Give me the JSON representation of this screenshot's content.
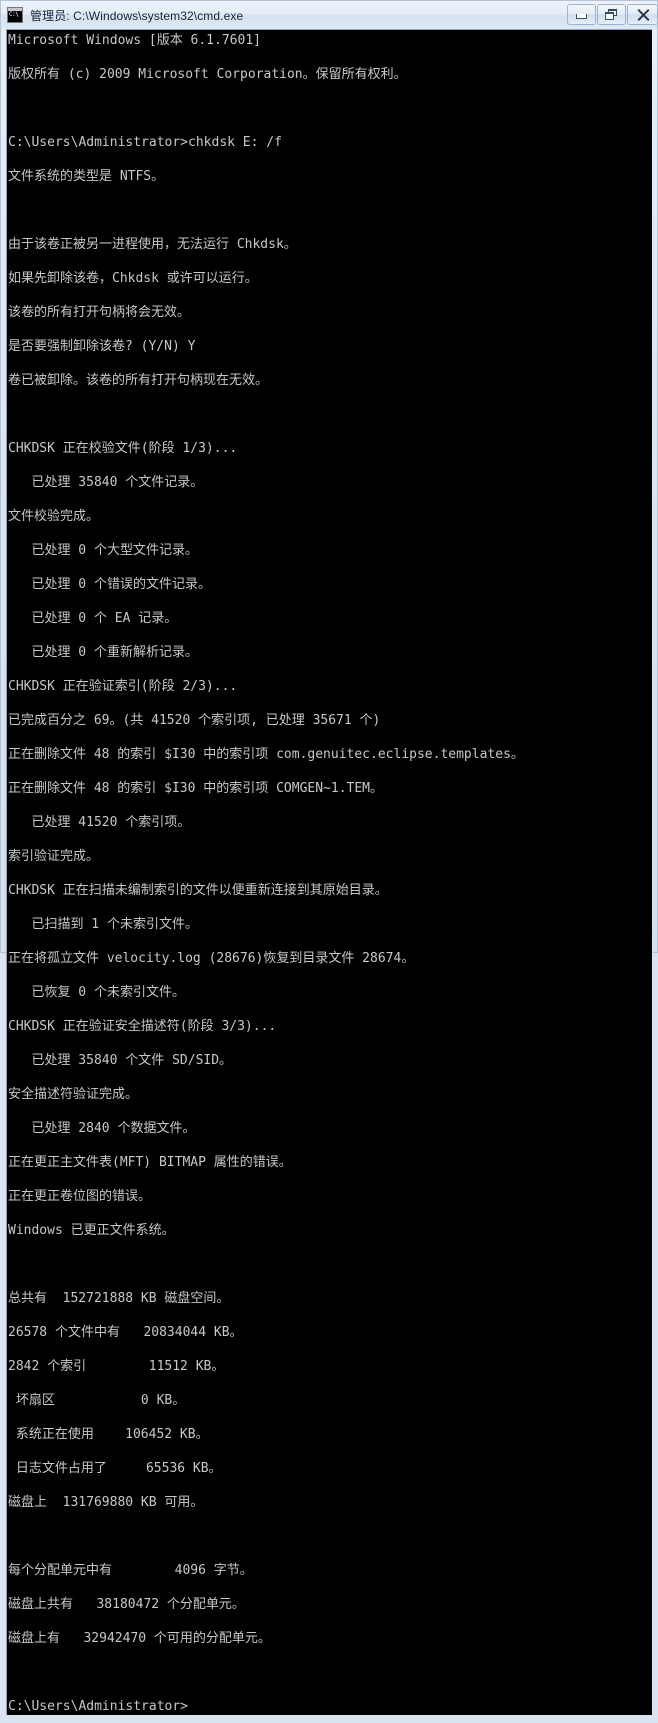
{
  "window": {
    "title": "管理员: C:\\Windows\\system32\\cmd.exe",
    "icon": "cmd-console-icon",
    "icon_glyph": "C:\\",
    "frame_color": "#d9e4f0",
    "titlebar_text_color": "#16243b",
    "controls": {
      "minimize": "最小化",
      "restore": "还原",
      "close": "关闭"
    }
  },
  "console": {
    "background": "#000000",
    "foreground": "#c8c8c8",
    "font_size_px": 13,
    "line_height_px": 17,
    "lines": [
      "Microsoft Windows [版本 6.1.7601]",
      "版权所有 (c) 2009 Microsoft Corporation。保留所有权利。",
      "",
      "C:\\Users\\Administrator>chkdsk E: /f",
      "文件系统的类型是 NTFS。",
      "",
      "由于该卷正被另一进程使用，无法运行 Chkdsk。",
      "如果先卸除该卷，Chkdsk 或许可以运行。",
      "该卷的所有打开句柄将会无效。",
      "是否要强制卸除该卷? (Y/N) Y",
      "卷已被卸除。该卷的所有打开句柄现在无效。",
      "",
      "CHKDSK 正在校验文件(阶段 1/3)...",
      "   已处理 35840 个文件记录。",
      "文件校验完成。",
      "   已处理 0 个大型文件记录。",
      "   已处理 0 个错误的文件记录。",
      "   已处理 0 个 EA 记录。",
      "   已处理 0 个重新解析记录。",
      "CHKDSK 正在验证索引(阶段 2/3)...",
      "已完成百分之 69。(共 41520 个索引项, 已处理 35671 个)",
      "正在删除文件 48 的索引 $I30 中的索引项 com.genuitec.eclipse.templates。",
      "正在删除文件 48 的索引 $I30 中的索引项 COMGEN~1.TEM。",
      "   已处理 41520 个索引项。",
      "索引验证完成。",
      "CHKDSK 正在扫描未编制索引的文件以便重新连接到其原始目录。",
      "   已扫描到 1 个未索引文件。",
      "正在将孤立文件 velocity.log (28676)恢复到目录文件 28674。",
      "   已恢复 0 个未索引文件。",
      "CHKDSK 正在验证安全描述符(阶段 3/3)...",
      "   已处理 35840 个文件 SD/SID。",
      "安全描述符验证完成。",
      "   已处理 2840 个数据文件。",
      "正在更正主文件表(MFT) BITMAP 属性的错误。",
      "正在更正卷位图的错误。",
      "Windows 已更正文件系统。",
      "",
      "总共有  152721888 KB 磁盘空间。",
      "26578 个文件中有   20834044 KB。",
      "2842 个索引        11512 KB。",
      " 坏扇区           0 KB。",
      " 系统正在使用    106452 KB。",
      " 日志文件占用了     65536 KB。",
      "磁盘上  131769880 KB 可用。",
      "",
      "每个分配单元中有        4096 字节。",
      "磁盘上共有   38180472 个分配单元。",
      "磁盘上有   32942470 个可用的分配单元。",
      "",
      "C:\\Users\\Administrator>"
    ]
  }
}
